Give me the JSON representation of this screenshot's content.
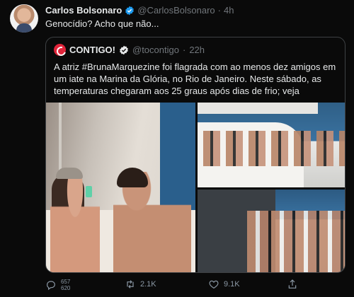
{
  "tweet": {
    "author_name": "Carlos Bolsonaro",
    "handle": "@CarlosBolsonaro",
    "dot": "·",
    "time": "4h",
    "text": "Genocídio? Acho que não..."
  },
  "quote": {
    "name": "CONTIGO!",
    "handle": "@tocontigo",
    "dot": "·",
    "time": "22h",
    "text": "A atriz #BrunaMarquezine foi flagrada com ao menos dez amigos em um iate na Marina da Glória, no Rio de Janeiro. Neste sábado, as temperaturas chegaram aos 25 graus após dias de frio; veja"
  },
  "actions": {
    "replies_line1": "657",
    "replies_line2": "620",
    "retweets": "2.1K",
    "likes": "9.1K"
  },
  "colors": {
    "background": "#0a0a0a",
    "text": "#e7e9ea",
    "muted": "#71767b",
    "verified": "#1d9bf0",
    "brand": "#e0243a"
  },
  "icons": [
    "verified-badge-icon",
    "contigo-logo",
    "reply-icon",
    "retweet-icon",
    "like-icon",
    "share-icon"
  ]
}
